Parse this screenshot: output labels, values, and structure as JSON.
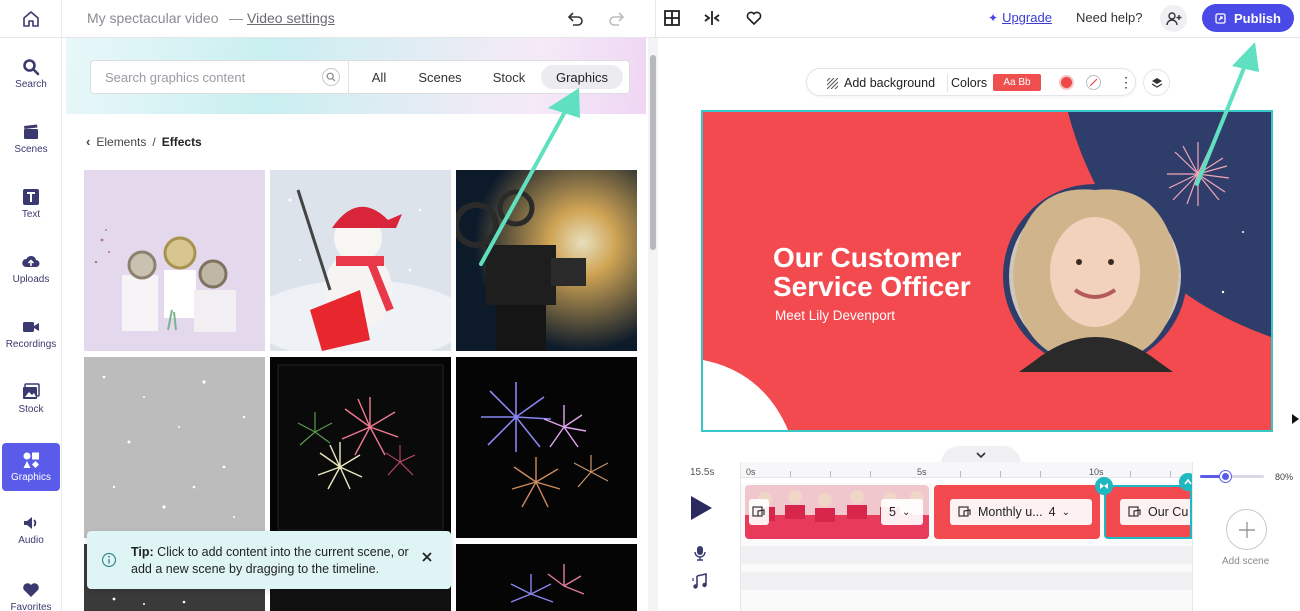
{
  "topbar": {
    "project_title": "My spectacular video",
    "separator": "—",
    "video_settings": "Video settings",
    "upgrade": "Upgrade",
    "need_help": "Need help?",
    "publish": "Publish"
  },
  "rail": {
    "items": [
      {
        "label": "Search",
        "icon": "search-icon"
      },
      {
        "label": "Scenes",
        "icon": "clapperboard-icon"
      },
      {
        "label": "Text",
        "icon": "text-icon"
      },
      {
        "label": "Uploads",
        "icon": "cloud-upload-icon"
      },
      {
        "label": "Recordings",
        "icon": "camera-icon"
      },
      {
        "label": "Stock",
        "icon": "image-icon"
      },
      {
        "label": "Graphics",
        "icon": "shapes-icon",
        "active": true
      },
      {
        "label": "Audio",
        "icon": "speaker-icon"
      },
      {
        "label": "Favorites",
        "icon": "heart-icon"
      }
    ]
  },
  "panel": {
    "search_placeholder": "Search graphics content",
    "tabs": [
      {
        "label": "All"
      },
      {
        "label": "Scenes"
      },
      {
        "label": "Stock"
      },
      {
        "label": "Graphics",
        "active": true
      }
    ],
    "breadcrumb": {
      "parent": "Elements",
      "separator": "/",
      "current": "Effects"
    },
    "tip": {
      "bold": "Tip:",
      "text": " Click to add content into the current scene, or add a new scene by dragging to the timeline."
    }
  },
  "stage": {
    "toolbar": {
      "add_background": "Add background",
      "colors": "Colors",
      "font_badge": "Aa Bb"
    },
    "canvas": {
      "title_line1": "Our Customer",
      "title_line2": "Service Officer",
      "subtitle": "Meet Lily Devenport"
    }
  },
  "timeline": {
    "duration": "15.5s",
    "ruler": [
      "0s",
      "5s",
      "10s"
    ],
    "clips": [
      {
        "count": "5"
      },
      {
        "label": "Monthly u...",
        "count": "4"
      },
      {
        "label": "Our Cu"
      }
    ],
    "zoom": "80%",
    "add_scene": "Add scene"
  },
  "colors": {
    "accent": "#4a4ae6",
    "teal": "#38c6c6",
    "scene_red": "#f24a4f",
    "scene_navy": "#2f3d6a"
  }
}
